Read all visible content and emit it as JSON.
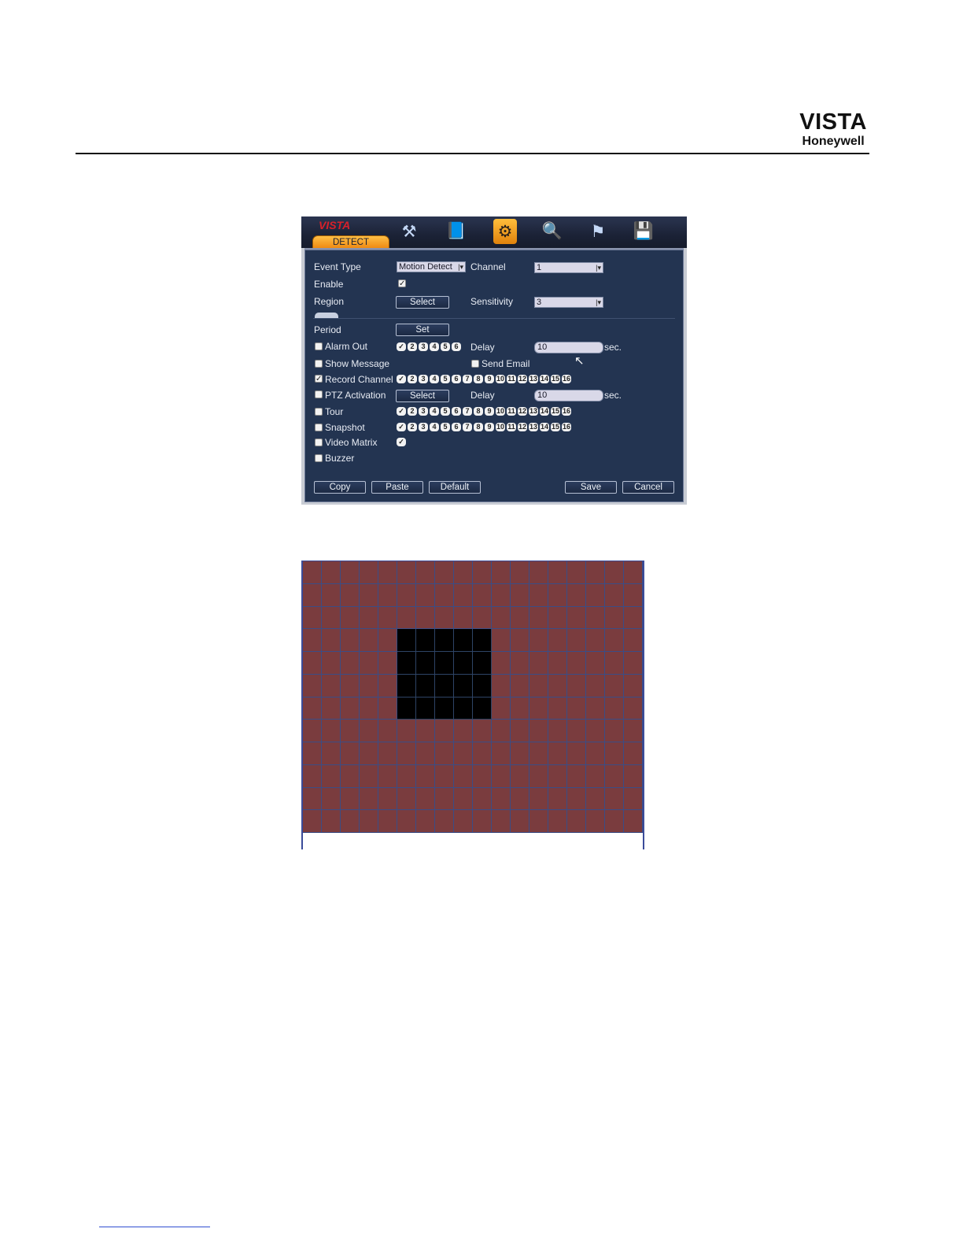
{
  "brand": {
    "line1": "VISTA",
    "line2": "Honeywell"
  },
  "dvr": {
    "logo": "VISTA",
    "active_tab": "DETECT",
    "icons": [
      "search-icon",
      "info-icon",
      "setting-icon",
      "advanced-icon",
      "backup-icon",
      "shutdown-icon"
    ],
    "labels": {
      "event_type": "Event Type",
      "channel": "Channel",
      "enable": "Enable",
      "region": "Region",
      "sensitivity": "Sensitivity",
      "period": "Period",
      "alarm_out": "Alarm Out",
      "delay": "Delay",
      "sec": "sec.",
      "show_message": "Show Message",
      "send_email": "Send Email",
      "record_channel": "Record Channel",
      "ptz_activation": "PTZ Activation",
      "tour": "Tour",
      "snapshot": "Snapshot",
      "video_matrix": "Video Matrix",
      "buzzer": "Buzzer"
    },
    "values": {
      "event_type": "Motion Detect",
      "channel": "1",
      "sensitivity": "3",
      "alarm_delay": "10",
      "ptz_delay": "10"
    },
    "checks": {
      "enable": true,
      "alarm_out": false,
      "show_message": false,
      "send_email": false,
      "record_channel": true,
      "ptz_activation": false,
      "tour": false,
      "snapshot": false,
      "video_matrix": false,
      "buzzer": false,
      "video_matrix_1": true
    },
    "alarm_out_numbers": [
      "2",
      "3",
      "4",
      "5",
      "6"
    ],
    "channel_numbers": [
      "2",
      "3",
      "4",
      "5",
      "6",
      "7",
      "8",
      "9",
      "10",
      "11",
      "12",
      "13",
      "14",
      "15",
      "16"
    ],
    "buttons": {
      "region_select": "Select",
      "period_set": "Set",
      "ptz_select": "Select",
      "copy": "Copy",
      "paste": "Paste",
      "default": "Default",
      "save": "Save",
      "cancel": "Cancel"
    }
  },
  "region_grid": {
    "columns": 18,
    "rows": 12,
    "deselected_rows": [
      3,
      4,
      5,
      6
    ],
    "deselected_cols": [
      5,
      6,
      7,
      8,
      9
    ]
  }
}
